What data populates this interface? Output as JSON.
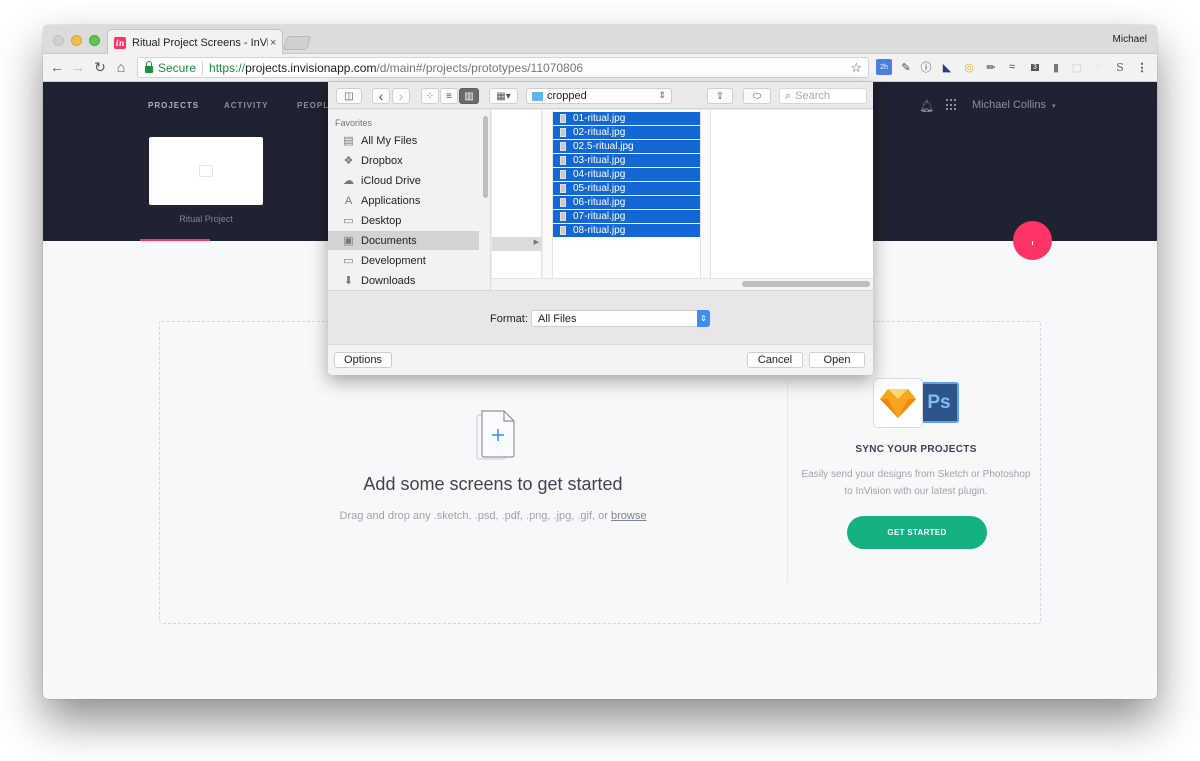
{
  "browser": {
    "tab_title": "Ritual Project Screens - InVision",
    "tab_close": "×",
    "favicon_label": "in",
    "profile_name": "Michael",
    "secure_label": "Secure",
    "url_scheme": "https://",
    "url_host": "projects.invisionapp.com",
    "url_path": "/d/main#/projects/prototypes/11070806",
    "nav": {
      "back": "←",
      "forward": "→",
      "reload": "↻",
      "home": "⌂",
      "bookmark": "☆"
    },
    "extensions": [
      "calendar-2h-icon",
      "eyedropper-icon",
      "onepassword-icon",
      "speedometer-icon",
      "ring-icon",
      "pencil-icon",
      "sneaker-icon",
      "adblock-icon",
      "bookmark-badge-icon",
      "box-icon",
      "circle-icon",
      "s-icon",
      "menu-icon"
    ],
    "extension_glyphs": [
      "▦",
      "✎",
      "ⓘ",
      "◣",
      "◎",
      "✏",
      "≈",
      "●",
      "▮",
      "▢",
      "○",
      "S",
      "⋮"
    ],
    "adblock_badge": "3",
    "calendar_badge": "2h"
  },
  "app": {
    "nav": [
      "PROJECTS",
      "ACTIVITY",
      "PEOPLE"
    ],
    "project_name": "Ritual Project",
    "user_name": "Michael Collins",
    "user_caret": "▾",
    "colors": {
      "header_bg": "#1f2230",
      "accent": "#ff3366",
      "cta": "#14b283"
    }
  },
  "main": {
    "empty_title": "Add some screens to get started",
    "empty_sub_prefix": "Drag and drop any .sketch, .psd, .pdf, .png, .jpg, .gif, or ",
    "browse_link": "browse",
    "sync_title": "SYNC YOUR PROJECTS",
    "sync_desc": "Easily send your designs from Sketch or Photoshop to InVision with our latest plugin.",
    "ps_label": "Ps",
    "get_started": "GET STARTED"
  },
  "dialog": {
    "current_folder": "cropped",
    "search_placeholder": "Search",
    "sidebar_heading": "Favorites",
    "sidebar_items": [
      {
        "label": "All My Files",
        "icon": "▤"
      },
      {
        "label": "Dropbox",
        "icon": "❖"
      },
      {
        "label": "iCloud Drive",
        "icon": "☁"
      },
      {
        "label": "Applications",
        "icon": "A"
      },
      {
        "label": "Desktop",
        "icon": "▭"
      },
      {
        "label": "Documents",
        "icon": "▣",
        "selected": true
      },
      {
        "label": "Development",
        "icon": "▭"
      },
      {
        "label": "Downloads",
        "icon": "⬇"
      }
    ],
    "files": [
      "01-ritual.jpg",
      "02-ritual.jpg",
      "02.5-ritual.jpg",
      "03-ritual.jpg",
      "04-ritual.jpg",
      "05-ritual.jpg",
      "06-ritual.jpg",
      "07-ritual.jpg",
      "08-ritual.jpg"
    ],
    "format_label": "Format:",
    "format_value": "All Files",
    "options_button": "Options",
    "cancel_button": "Cancel",
    "open_button": "Open",
    "toolbar_glyphs": {
      "sidebar": "◫",
      "back": "‹",
      "forward": "›",
      "icons": "⁘",
      "list": "≡",
      "columns": "▥",
      "arrange": "▦▾",
      "share": "⇪",
      "tag": "⬭",
      "search": "⌕",
      "popup": "⌃⌄"
    }
  }
}
